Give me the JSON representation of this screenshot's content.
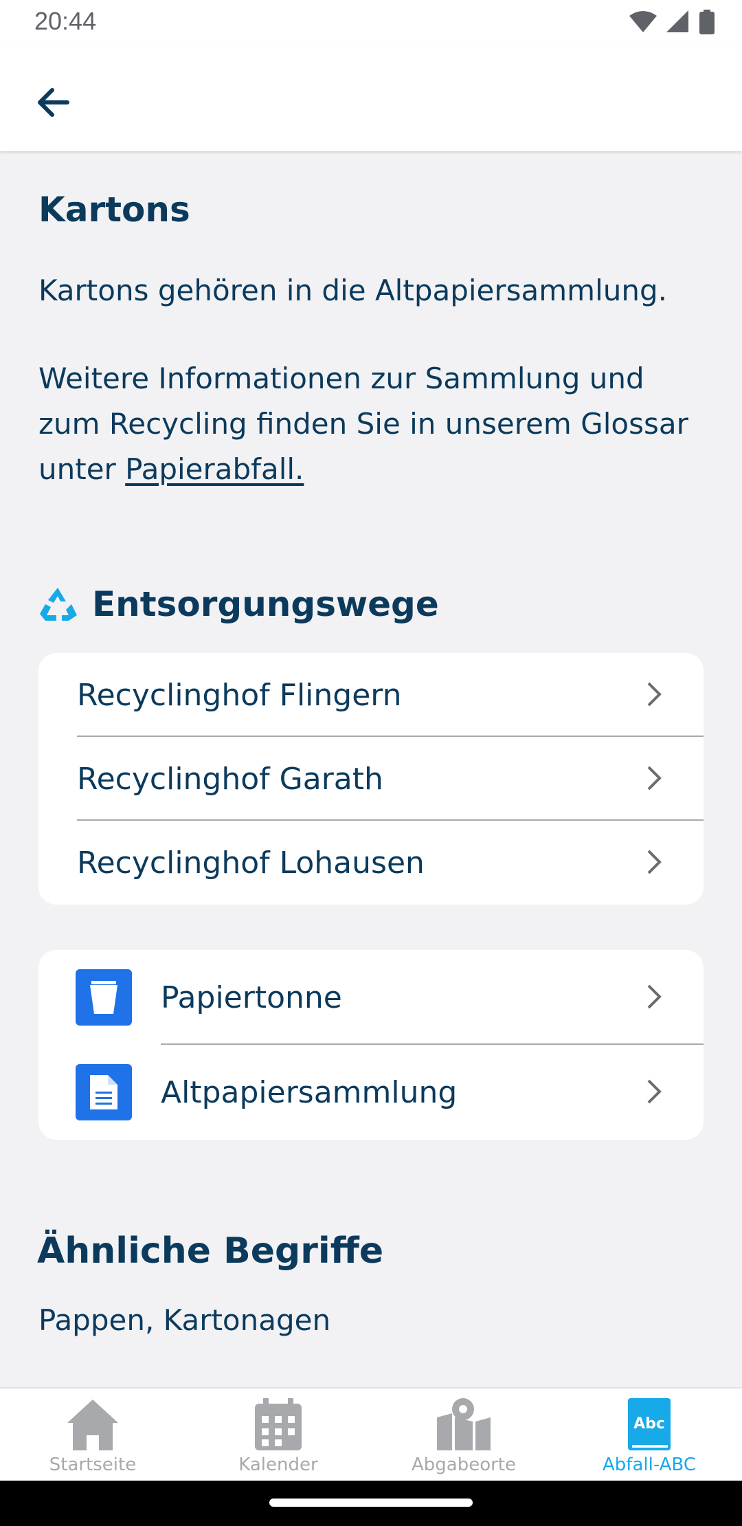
{
  "status_bar": {
    "time": "20:44"
  },
  "page": {
    "title": "Kartons",
    "intro": "Kartons gehören in die Altpapiersammlung.",
    "info_lines": [
      "Weitere Informationen zur Sammlung und",
      "zum Recycling finden Sie in unserem Glossar"
    ],
    "info_prefix": "unter ",
    "info_link": "Papierabfall."
  },
  "disposal": {
    "heading": "Entsorgungswege",
    "recycling_centers": [
      {
        "label": "Recyclinghof Flingern"
      },
      {
        "label": "Recyclinghof Garath"
      },
      {
        "label": "Recyclinghof Lohausen"
      }
    ],
    "collections": [
      {
        "label": "Papiertonne",
        "icon": "bin-icon"
      },
      {
        "label": "Altpapiersammlung",
        "icon": "document-icon"
      }
    ]
  },
  "similar": {
    "heading": "Ähnliche Begriffe",
    "terms": "Pappen, Kartonagen"
  },
  "bottom_nav": {
    "items": [
      {
        "label": "Startseite",
        "icon": "home-icon"
      },
      {
        "label": "Kalender",
        "icon": "calendar-icon"
      },
      {
        "label": "Abgabeorte",
        "icon": "map-icon"
      },
      {
        "label": "Abfall-ABC",
        "icon": "book-abc-icon",
        "badge": "Abc",
        "active": true
      }
    ]
  },
  "colors": {
    "text": "#0b3a5c",
    "accent": "#17a9e8",
    "tile": "#1f72e8",
    "nav_inactive": "#a7a9ad",
    "background": "#f2f2f4"
  }
}
